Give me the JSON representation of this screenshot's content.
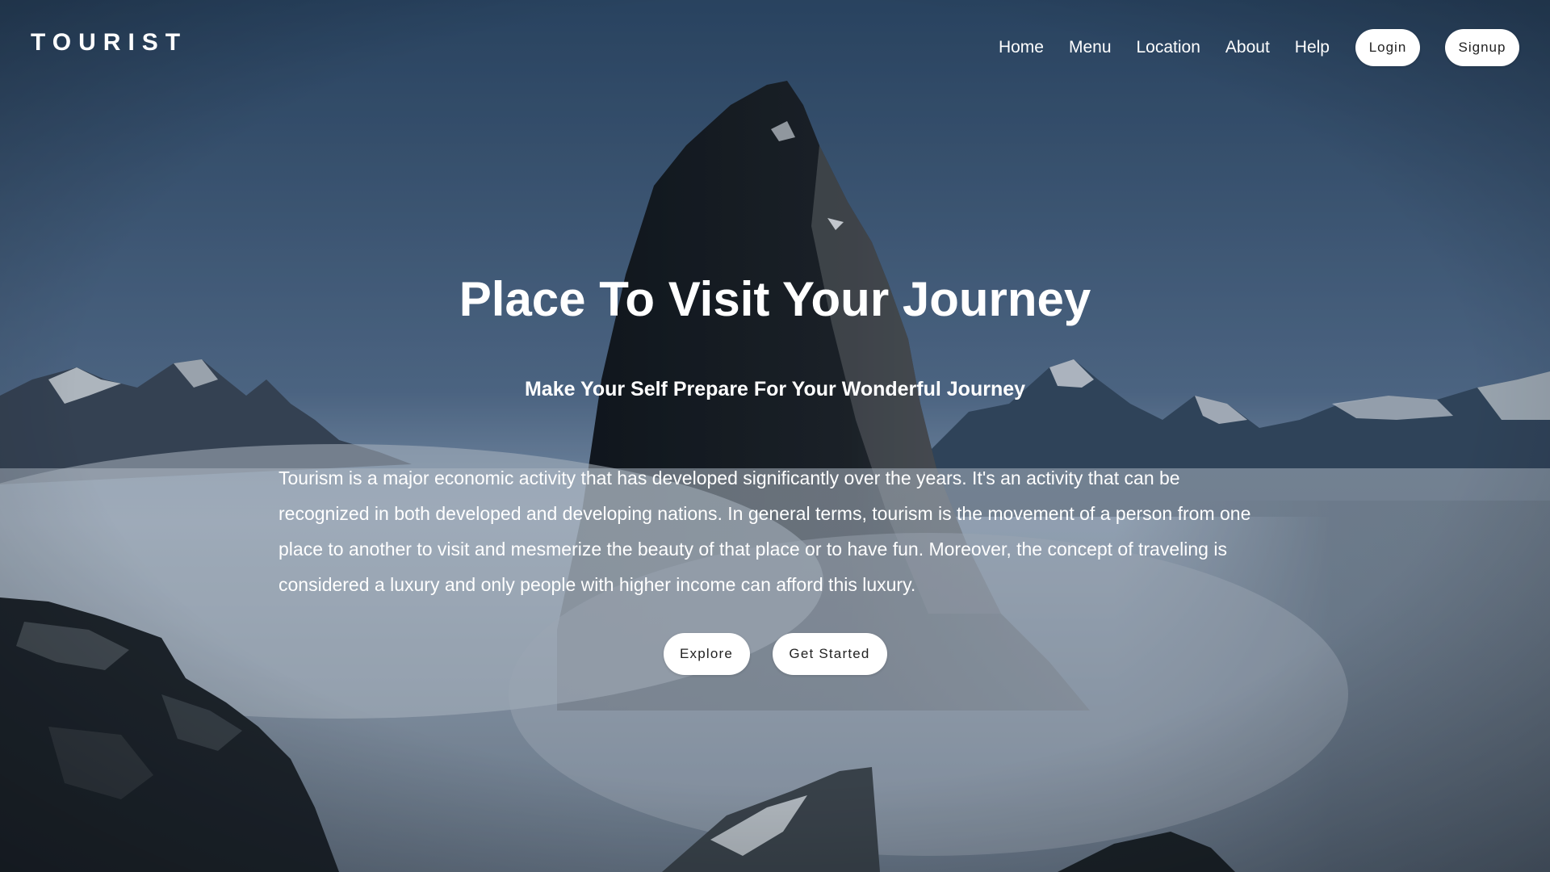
{
  "brand": {
    "name": "TOURIST"
  },
  "nav": {
    "links": [
      "Home",
      "Menu",
      "Location",
      "About",
      "Help"
    ],
    "login_label": "Login",
    "signup_label": "Signup"
  },
  "hero": {
    "title": "Place To Visit Your Journey",
    "subtitle": "Make Your Self Prepare For Your Wonderful Journey",
    "paragraph": "Tourism is a major economic activity that has developed significantly over the years. It's an activity that can be recognized in both developed and developing nations. In general terms, tourism is the movement of a person from one place to another to visit and mesmerize the beauty of that place or to have fun. Moreover, the concept of traveling is considered a luxury and only people with higher income can afford this luxury.",
    "explore_label": "Explore",
    "get_started_label": "Get Started"
  },
  "colors": {
    "sky_top": "#33506f",
    "sky_bottom": "#8aa2bd",
    "button_bg": "#ffffff",
    "button_text": "#222222",
    "text": "#ffffff"
  }
}
